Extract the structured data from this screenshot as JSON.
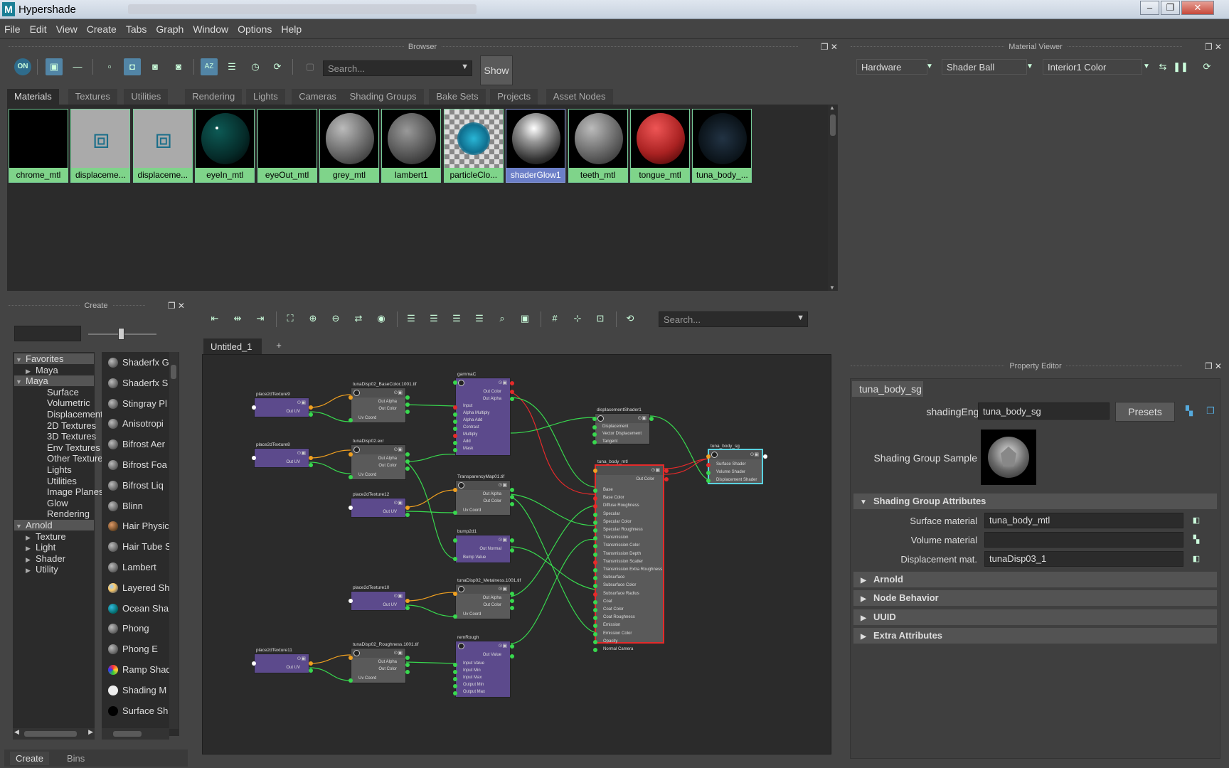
{
  "window": {
    "title": "Hypershade",
    "app_icon": "M"
  },
  "menu": [
    "File",
    "Edit",
    "View",
    "Create",
    "Tabs",
    "Graph",
    "Window",
    "Options",
    "Help"
  ],
  "browser": {
    "title": "Browser",
    "toggle_label": "ON",
    "search_placeholder": "Search...",
    "show_label": "Show",
    "tabs": [
      "Materials",
      "Textures",
      "Utilities",
      "Rendering",
      "Lights",
      "Cameras",
      "Shading Groups",
      "Bake Sets",
      "Projects",
      "Asset Nodes"
    ],
    "materials": [
      {
        "name": "chrome_mtl",
        "kind": "black"
      },
      {
        "name": "displaceme...",
        "kind": "cube"
      },
      {
        "name": "displaceme...",
        "kind": "cube"
      },
      {
        "name": "eyeIn_mtl",
        "kind": "eye"
      },
      {
        "name": "eyeOut_mtl",
        "kind": "black"
      },
      {
        "name": "grey_mtl",
        "kind": "grey"
      },
      {
        "name": "lambert1",
        "kind": "grey2"
      },
      {
        "name": "particleClo...",
        "kind": "checker"
      },
      {
        "name": "shaderGlow1",
        "kind": "glow",
        "selected": true
      },
      {
        "name": "teeth_mtl",
        "kind": "grey"
      },
      {
        "name": "tongue_mtl",
        "kind": "red"
      },
      {
        "name": "tuna_body_...",
        "kind": "tuna"
      }
    ]
  },
  "material_viewer": {
    "title": "Material Viewer",
    "renderer": "Hardware",
    "shape": "Shader Ball",
    "env": "Interior1 Color"
  },
  "create": {
    "title": "Create",
    "tree": [
      {
        "label": "Favorites",
        "level": 0,
        "open": true
      },
      {
        "label": "Maya",
        "level": 1,
        "open": false
      },
      {
        "label": "Maya",
        "level": 0,
        "open": true
      },
      {
        "label": "Surface",
        "level": 2
      },
      {
        "label": "Volumetric",
        "level": 2
      },
      {
        "label": "Displacement",
        "level": 2
      },
      {
        "label": "2D Textures",
        "level": 2
      },
      {
        "label": "3D Textures",
        "level": 2
      },
      {
        "label": "Env Textures",
        "level": 2
      },
      {
        "label": "Other Textures",
        "level": 2
      },
      {
        "label": "Lights",
        "level": 2
      },
      {
        "label": "Utilities",
        "level": 2
      },
      {
        "label": "Image Planes",
        "level": 2
      },
      {
        "label": "Glow",
        "level": 2
      },
      {
        "label": "Rendering",
        "level": 2
      },
      {
        "label": "Arnold",
        "level": 0,
        "open": true
      },
      {
        "label": "Texture",
        "level": 1,
        "open": false
      },
      {
        "label": "Light",
        "level": 1,
        "open": false
      },
      {
        "label": "Shader",
        "level": 1,
        "open": false
      },
      {
        "label": "Utility",
        "level": 1,
        "open": false
      }
    ],
    "nodes": [
      "Shaderfx G",
      "Shaderfx S",
      "Stingray Pl",
      "Anisotropi",
      "Bifrost Aer",
      "Bifrost Foa",
      "Bifrost Liq",
      "Blinn",
      "Hair Physic",
      "Hair Tube S",
      "Lambert",
      "Layered Sh",
      "Ocean Sha",
      "Phong",
      "Phong E",
      "Ramp Shad",
      "Shading M",
      "Surface Sh"
    ],
    "bottom_tabs": [
      "Create",
      "Bins"
    ]
  },
  "node_editor": {
    "search_placeholder": "Search...",
    "tab": "Untitled_1",
    "add_tab": "+",
    "nodes": {
      "p9": {
        "title": "place2dTexture9",
        "out": "Out UV"
      },
      "p8": {
        "title": "place2dTexture8",
        "out": "Out UV"
      },
      "p12": {
        "title": "place2dTexture12",
        "out": "Out UV"
      },
      "p10": {
        "title": "place2dTexture10",
        "out": "Out UV"
      },
      "p11": {
        "title": "place2dTexture11",
        "out": "Out UV"
      },
      "tBase": {
        "title": "tunaDisp02_BaseColor.1001.tif",
        "rows": [
          "Out Alpha",
          "Out Color",
          "Uv Coord"
        ]
      },
      "tExr": {
        "title": "tunaDisp02.exr",
        "rows": [
          "Out Alpha",
          "Out Color",
          "Uv Coord"
        ]
      },
      "tTrans": {
        "title": "TransparencyMap01.tif",
        "rows": [
          "Out Alpha",
          "Out Color",
          "Uv Coord"
        ]
      },
      "tMetal": {
        "title": "tunaDisp02_Metalness.1001.tif",
        "rows": [
          "Out Alpha",
          "Out Color",
          "Uv Coord"
        ]
      },
      "tRough": {
        "title": "tunaDisp02_Roughness.1001.tif",
        "rows": [
          "Out Alpha",
          "Out Color",
          "Uv Coord"
        ]
      },
      "gamma": {
        "title": "gammaC",
        "rows": [
          "Out Color",
          "Out Alpha",
          "Input",
          "Alpha Multiply",
          "Alpha Add",
          "Contrast",
          "Multiply",
          "Add",
          "Mask"
        ]
      },
      "bump": {
        "title": "bump2d1",
        "rows": [
          "Out Normal",
          "Bump Value"
        ]
      },
      "remap": {
        "title": "remRough",
        "rows": [
          "Out Value",
          "Input Value",
          "Input Min",
          "Input Max",
          "Output Min",
          "Output Max"
        ]
      },
      "disp": {
        "title": "displacementShader1",
        "rows": [
          "Displacement",
          "Vector Displacement",
          "Tangent"
        ]
      },
      "mtl": {
        "title": "tuna_body_mtl",
        "out": "Out Color",
        "attrs": [
          "Base",
          "Base Color",
          "Diffuse Roughness",
          "Specular",
          "Specular Color",
          "Specular Roughness",
          "Transmission",
          "Transmission Color",
          "Transmission Depth",
          "Transmission Scatter",
          "Transmission Extra Roughness",
          "Subsurface",
          "Subsurface Color",
          "Subsurface Radius",
          "Coat",
          "Coat Color",
          "Coat Roughness",
          "Emission",
          "Emission Color",
          "Opacity",
          "Normal Camera"
        ]
      },
      "sg": {
        "title": "tuna_body_sg",
        "rows": [
          "Surface Shader",
          "Volume Shader",
          "Displacement Shader"
        ]
      }
    }
  },
  "property_editor": {
    "title": "Property Editor",
    "tab": "tuna_body_sg",
    "shading_engine_label": "shadingEngine:",
    "shading_engine_value": "tuna_body_sg",
    "presets_label": "Presets",
    "sample_label": "Shading Group Sample",
    "section_open": "Shading Group Attributes",
    "surface_label": "Surface material",
    "surface_value": "tuna_body_mtl",
    "volume_label": "Volume material",
    "volume_value": "",
    "disp_label": "Displacement mat.",
    "disp_value": "tunaDisp03_1",
    "sections": [
      "Arnold",
      "Node Behavior",
      "UUID",
      "Extra Attributes"
    ]
  },
  "colors": {
    "accent": "#5285a6",
    "swatch_label": "#7fd48a",
    "node_purple": "#5c4a8c",
    "selected_red": "#e02020",
    "selected_cyan": "#5ad2e0"
  }
}
